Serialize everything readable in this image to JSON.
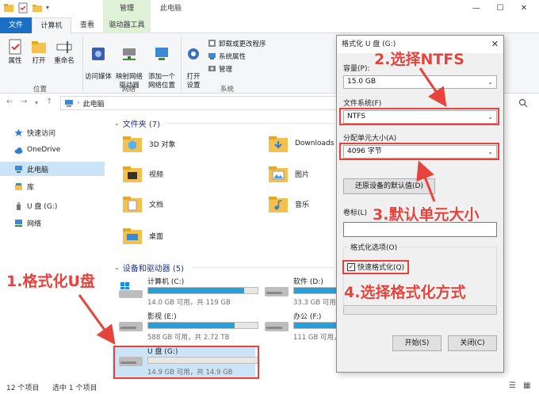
{
  "titlebar": {
    "manage_tab": "管理",
    "title": "此电脑",
    "minimize": "—",
    "maximize": "☐",
    "close": "✕"
  },
  "ribbon_tabs": {
    "file": "文件",
    "computer": "计算机",
    "view": "查看",
    "drive_tools": "驱动器工具"
  },
  "ribbon": {
    "properties": "属性",
    "open": "打开",
    "rename": "重命名",
    "location_group": "位置",
    "access_media": "访问媒体",
    "map_drive": "映射网络\n驱动器",
    "add_location": "添加一个\n网络位置",
    "network_group": "网络",
    "open_settings": "打开\n设置",
    "uninstall": "卸载或更改程序",
    "system_props": "系统属性",
    "manage": "管理",
    "system_group": "系统"
  },
  "address": {
    "path": "此电脑"
  },
  "sidebar": {
    "items": [
      {
        "label": "快速访问"
      },
      {
        "label": "OneDrive"
      },
      {
        "label": "此电脑"
      },
      {
        "label": "库"
      },
      {
        "label": "U 盘 (G:)"
      },
      {
        "label": "网络"
      }
    ]
  },
  "content": {
    "folders_header": "文件夹 (7)",
    "folders": [
      "3D 对象",
      "Downloads",
      "视频",
      "图片",
      "文档",
      "音乐",
      "桌面"
    ],
    "drives_header": "设备和驱动器 (5)",
    "drives": [
      {
        "name": "计算机 (C:)",
        "free": "14.0 GB 可用，共 119 GB",
        "used": 0.88
      },
      {
        "name": "软件 (D:)",
        "free": "33.3 GB 可用，共",
        "used": 0.7
      },
      {
        "name": "影视 (E:)",
        "free": "588 GB 可用，共 2.72 TB",
        "used": 0.79
      },
      {
        "name": "办公 (F:)",
        "free": "111 GB 可用，共",
        "used": 0.45
      },
      {
        "name": "U 盘 (G:)",
        "free": "14.9 GB 可用，共 14.9 GB",
        "used": 0.0
      }
    ]
  },
  "statusbar": {
    "count": "12 个项目",
    "selected": "选中 1 个项目"
  },
  "dialog": {
    "title": "格式化 U 盘 (G:)",
    "close": "✕",
    "capacity_label": "容量(P):",
    "capacity_value": "15.0 GB",
    "fs_label": "文件系统(F)",
    "fs_value": "NTFS",
    "unit_label": "分配单元大小(A)",
    "unit_value": "4096 字节",
    "restore_button": "还原设备的默认值(D)",
    "volume_label": "卷标(L)",
    "volume_value": "",
    "options_legend": "格式化选项(O)",
    "quick_format": "快速格式化(Q)",
    "start_button": "开始(S)",
    "close_button": "关闭(C)"
  },
  "annotations": {
    "step1": "1.格式化U盘",
    "step2": "2.选择NTFS",
    "step3": "3.默认单元大小",
    "step4": "4.选择格式化方式"
  },
  "colors": {
    "accent": "#1a6fc4",
    "annotation": "#e8423c",
    "drive_bar": "#26a0da"
  }
}
